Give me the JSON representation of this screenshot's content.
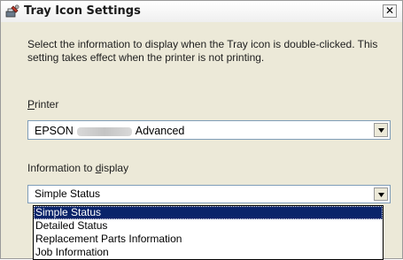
{
  "window": {
    "title": "Tray Icon Settings",
    "close_glyph": "✕",
    "description": "Select the information to display when the Tray icon is double-clicked. This setting takes effect when the printer is not printing."
  },
  "printer": {
    "label_accel": "P",
    "label_rest": "rinter",
    "value_prefix": "EPSON",
    "value_suffix": "Advanced"
  },
  "information": {
    "label_before": "Information to ",
    "label_accel": "d",
    "label_after": "isplay",
    "selected_value": "Simple Status",
    "options": [
      "Simple Status",
      "Detailed Status",
      "Replacement Parts Information",
      "Job Information"
    ],
    "highlighted_index": 0
  },
  "icons": {
    "title": "printer-wrench-icon",
    "close": "close-icon",
    "dropdown": "chevron-down-icon"
  },
  "colors": {
    "selection": "#0a246a",
    "dialog_bg": "#ece9d8",
    "border": "#7f9db9"
  }
}
